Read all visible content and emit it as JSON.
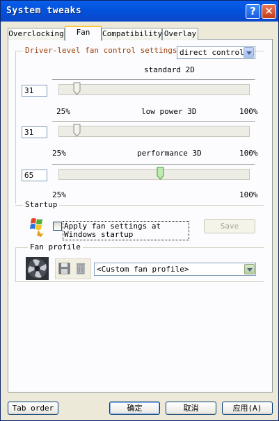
{
  "window": {
    "title": "System tweaks"
  },
  "tabs": [
    {
      "label": "Overclocking"
    },
    {
      "label": "Fan"
    },
    {
      "label": "Compatibility"
    },
    {
      "label": "Overlay"
    }
  ],
  "fan_control": {
    "group_label": "Driver-level fan control settings",
    "mode": "direct control",
    "sections": [
      {
        "title": "standard 2D",
        "value": "31",
        "level_percent": 31,
        "min_label": "25%",
        "max_label": "100%"
      },
      {
        "title": "low power 3D",
        "value": "31",
        "level_percent": 31,
        "min_label": "25%",
        "max_label": "100%"
      },
      {
        "title": "performance 3D",
        "value": "65",
        "level_percent": 65,
        "min_label": "25%",
        "max_label": "100%"
      }
    ]
  },
  "startup": {
    "group_label": "Startup",
    "checkbox_label": "Apply fan settings at Windows startup",
    "checked": false,
    "save_label": "Save"
  },
  "fan_profile": {
    "group_label": "Fan profile",
    "selected": "<Custom fan profile>"
  },
  "footer": {
    "tab_order": "Tab order",
    "ok": "确定",
    "cancel": "取消",
    "apply": "应用(A)"
  }
}
